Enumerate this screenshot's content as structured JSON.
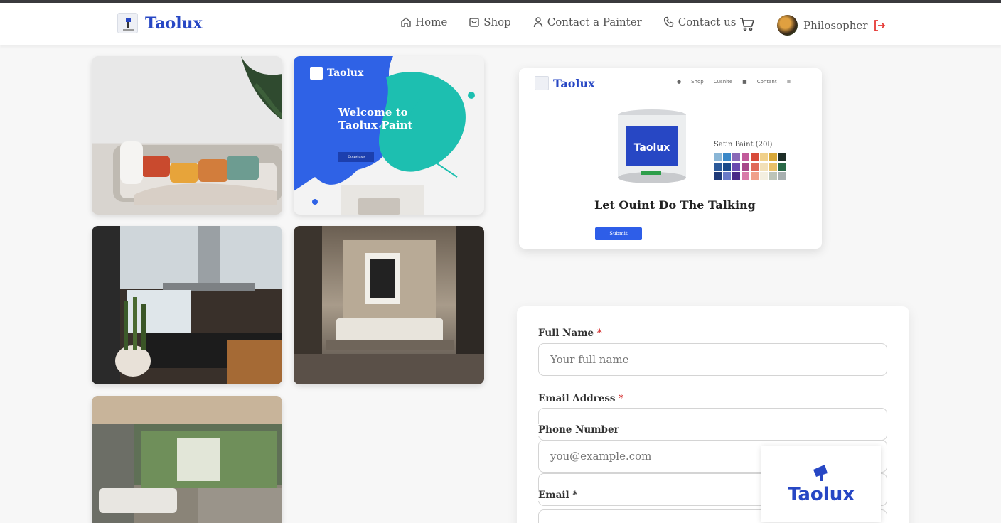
{
  "header": {
    "brand": "Taolux",
    "nav": [
      {
        "label": "Home",
        "icon": "home-icon"
      },
      {
        "label": "Shop",
        "icon": "shopping-bag-icon"
      },
      {
        "label": "Contact a Painter",
        "icon": "user-icon"
      },
      {
        "label": "Contact us",
        "icon": "phone-icon"
      }
    ],
    "cart_icon": "cart-icon",
    "user_name": "Philosopher",
    "logout_icon": "logout-icon",
    "logout_color": "#e53935"
  },
  "gallery": {
    "promo": {
      "brand": "Taolux",
      "title_line1": "Welcome to",
      "title_line2": "Taolux Paint",
      "button": "Donetuse"
    }
  },
  "mockup": {
    "brand": "Taolux",
    "nav": [
      "Shop",
      "Cusnite",
      "Contant"
    ],
    "can_label": "Taolux",
    "product": "Satin Paint (20l)",
    "headline": "Let Ouint Do The Talking",
    "button": "Submit"
  },
  "form": {
    "full_name_label": "Full Name",
    "full_name_placeholder": "Your full name",
    "email_label": "Email Address",
    "phone_label": "Phone Number",
    "phone_placeholder": "you@example.com",
    "email2_label": "Email",
    "required_mark": "*"
  },
  "badge": {
    "brand": "Taolux"
  },
  "colors": {
    "brand_blue": "#2747c4",
    "accent_blue": "#2e5ee8",
    "teal": "#1dbfb0",
    "required_red": "#d42e2e"
  }
}
